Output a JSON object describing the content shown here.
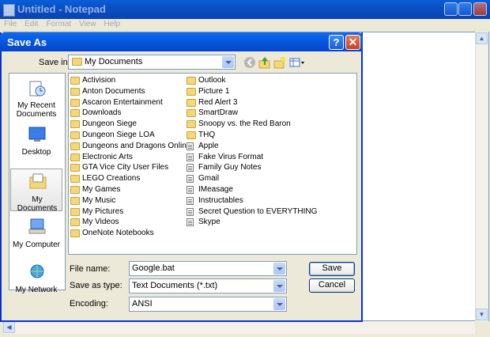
{
  "notepad": {
    "title": "Untitled - Notepad",
    "menu": [
      "File",
      "Edit",
      "Format",
      "View",
      "Help"
    ]
  },
  "dialog": {
    "title": "Save As",
    "help_label": "?",
    "close_label": "X",
    "save_in_label": "Save in:",
    "save_in_value": "My Documents",
    "places": [
      "My Recent Documents",
      "Desktop",
      "My Documents",
      "My Computer",
      "My Network"
    ],
    "files_col1": [
      {
        "name": "Activision",
        "type": "folder"
      },
      {
        "name": "Anton Documents",
        "type": "folder"
      },
      {
        "name": "Ascaron Entertainment",
        "type": "folder"
      },
      {
        "name": "Downloads",
        "type": "folder"
      },
      {
        "name": "Dungeon Siege",
        "type": "folder"
      },
      {
        "name": "Dungeon Siege LOA",
        "type": "folder"
      },
      {
        "name": "Dungeons and Dragons Online",
        "type": "folder"
      },
      {
        "name": "Electronic Arts",
        "type": "folder"
      },
      {
        "name": "GTA Vice City User Files",
        "type": "folder"
      },
      {
        "name": "LEGO Creations",
        "type": "folder"
      },
      {
        "name": "My Games",
        "type": "folder"
      },
      {
        "name": "My Music",
        "type": "folder"
      },
      {
        "name": "My Pictures",
        "type": "folder"
      },
      {
        "name": "My Videos",
        "type": "folder"
      },
      {
        "name": "OneNote Notebooks",
        "type": "folder"
      }
    ],
    "files_col2": [
      {
        "name": "Outlook",
        "type": "folder"
      },
      {
        "name": "Picture 1",
        "type": "folder"
      },
      {
        "name": "Red Alert 3",
        "type": "folder"
      },
      {
        "name": "SmartDraw",
        "type": "folder"
      },
      {
        "name": "Snoopy vs. the Red Baron",
        "type": "folder"
      },
      {
        "name": "THQ",
        "type": "folder"
      },
      {
        "name": "Apple",
        "type": "document"
      },
      {
        "name": "Fake Virus Format",
        "type": "document"
      },
      {
        "name": "Family Guy Notes",
        "type": "document"
      },
      {
        "name": "Gmail",
        "type": "document"
      },
      {
        "name": "IMeasage",
        "type": "document"
      },
      {
        "name": "Instructables",
        "type": "document"
      },
      {
        "name": "Secret Question to EVERYTHING",
        "type": "document"
      },
      {
        "name": "Skype",
        "type": "document"
      }
    ],
    "file_name_label": "File name:",
    "file_name_value": "Google.bat",
    "save_as_type_label": "Save as type:",
    "save_as_type_value": "Text Documents (*.txt)",
    "encoding_label": "Encoding:",
    "encoding_value": "ANSI",
    "save_button": "Save",
    "cancel_button": "Cancel"
  },
  "colors": {
    "title_bar": "#0856dc",
    "folder": "#f4d77a",
    "window_bg": "#ece9d8"
  }
}
